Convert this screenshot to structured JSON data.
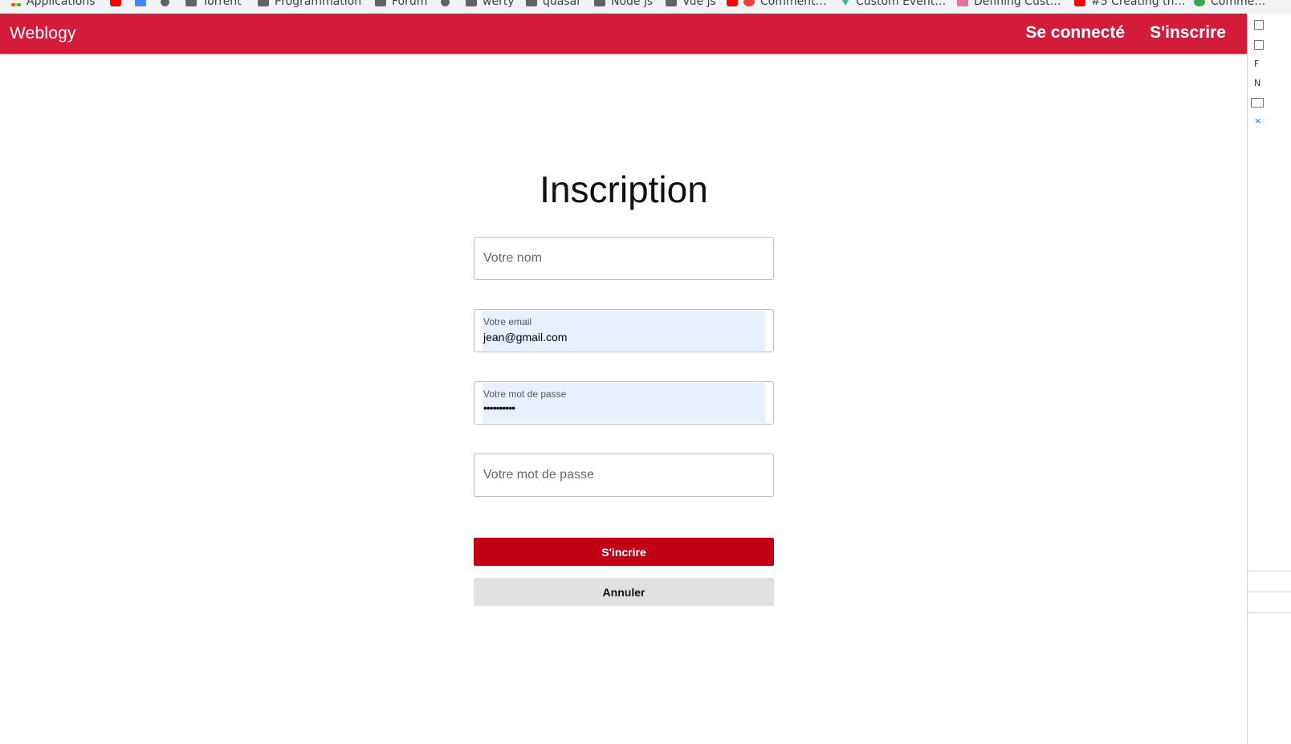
{
  "bookmarks": [
    {
      "icon": "apps-icon",
      "label": "Applications"
    },
    {
      "icon": "youtube-icon",
      "label": ""
    },
    {
      "icon": "translate-icon",
      "label": ""
    },
    {
      "icon": "circle-icon",
      "label": ""
    },
    {
      "icon": "folder-icon",
      "label": "Torrent"
    },
    {
      "icon": "folder-icon",
      "label": "Programmation"
    },
    {
      "icon": "folder-icon",
      "label": "Forum"
    },
    {
      "icon": "gear-icon",
      "label": ""
    },
    {
      "icon": "folder-icon",
      "label": "werty"
    },
    {
      "icon": "folder-icon",
      "label": "quasar"
    },
    {
      "icon": "folder-icon",
      "label": "Node js"
    },
    {
      "icon": "folder-icon",
      "label": "Vue js"
    },
    {
      "icon": "youtube-icon",
      "label": "Comment…"
    },
    {
      "icon": "vue-icon",
      "label": "Custom Event…"
    },
    {
      "icon": "page-icon",
      "label": "Defining Cust…"
    },
    {
      "icon": "youtube-icon",
      "label": "#5 Creating th…"
    },
    {
      "icon": "link-icon",
      "label": "Comme…"
    }
  ],
  "header": {
    "brand": "Weblogy",
    "nav_login": "Se connecté",
    "nav_signup": "S'inscrire"
  },
  "form": {
    "title": "Inscription",
    "name_placeholder": "Votre nom",
    "email_label": "Votre email",
    "email_value": "jean@gmail.com",
    "password_label": "Votre mot de passe",
    "password_value": "••••••••••",
    "confirm_placeholder": "Votre mot de passe",
    "submit_label": "S'incrire",
    "cancel_label": "Annuler"
  },
  "colors": {
    "header_bg": "#d21c3a",
    "primary_button": "#c10015",
    "secondary_button": "#e0e0e0",
    "autofill_bg": "#e8f0fe"
  }
}
